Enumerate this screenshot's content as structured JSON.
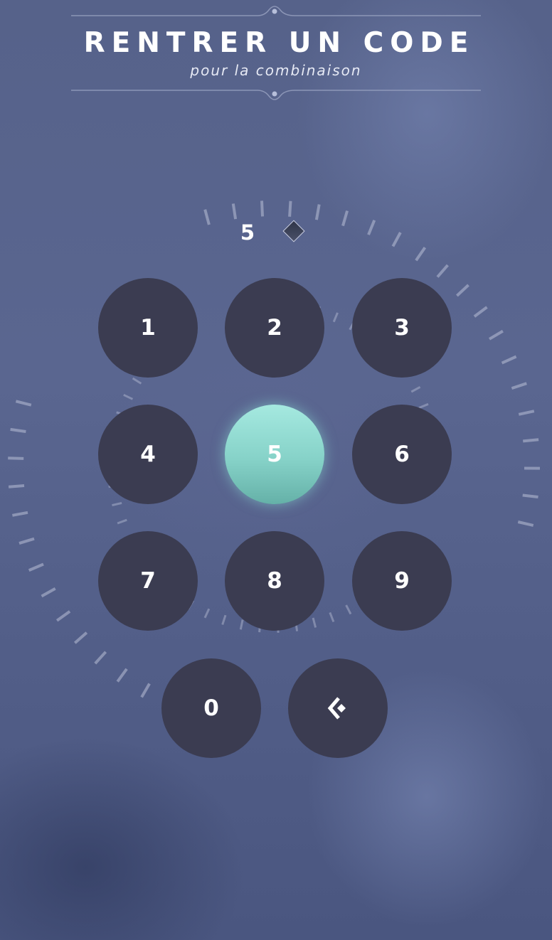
{
  "header": {
    "title": "RENTRER UN CODE",
    "subtitle": "pour la combinaison"
  },
  "code_display": {
    "entered_digits": [
      "5"
    ],
    "slots": 2,
    "empty_slot_icon": "diamond-icon"
  },
  "keypad": {
    "keys": [
      {
        "label": "1",
        "active": false
      },
      {
        "label": "2",
        "active": false
      },
      {
        "label": "3",
        "active": false
      },
      {
        "label": "4",
        "active": false
      },
      {
        "label": "5",
        "active": true
      },
      {
        "label": "6",
        "active": false
      },
      {
        "label": "7",
        "active": false
      },
      {
        "label": "8",
        "active": false
      },
      {
        "label": "9",
        "active": false
      },
      {
        "label": "0",
        "active": false
      }
    ],
    "backspace_icon": "backspace-chevron-icon"
  },
  "colors": {
    "key_background": "#3b3c51",
    "key_active": "#8fd9ce",
    "text": "#ffffff"
  }
}
